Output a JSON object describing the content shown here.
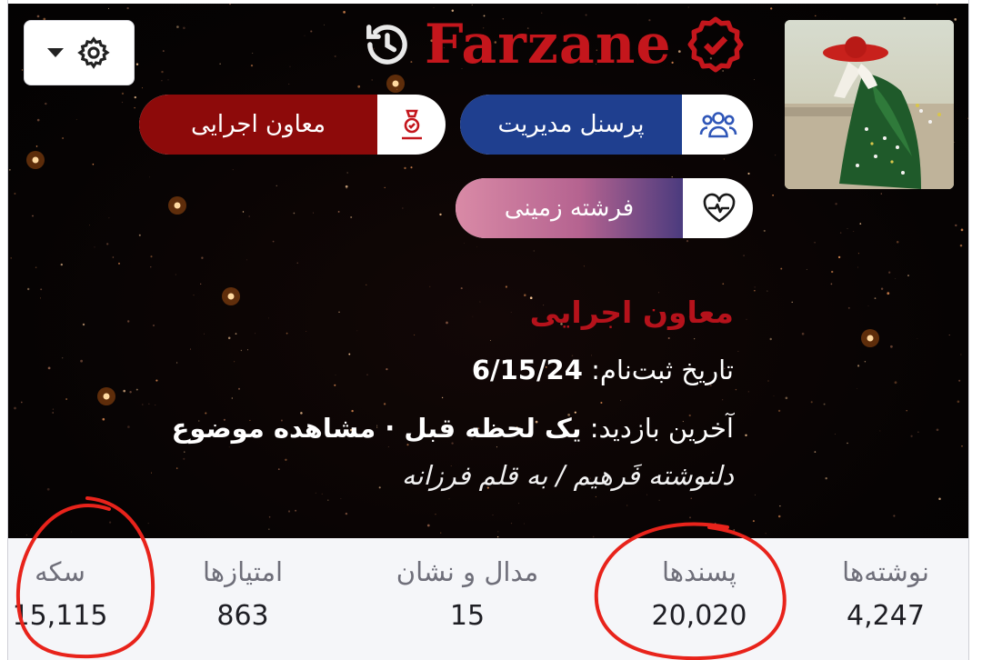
{
  "header": {
    "username": "Farzane",
    "settings_icon": "gear-icon",
    "history_icon": "history-icon",
    "verified_icon": "verified-badge-icon"
  },
  "badges": {
    "management": {
      "label": "پرسنل مدیریت",
      "icon": "users-icon",
      "color": "#1f3f8f"
    },
    "executive": {
      "label": "معاون اجرایی",
      "icon": "award-icon",
      "color": "#8d0a0a"
    },
    "angel": {
      "label": "فرشته زمینی",
      "icon": "heart-pulse-icon",
      "color": "#d07a9a"
    }
  },
  "profile": {
    "role": "معاون اجرایی",
    "joined_label": "تاریخ ثبت‌نام:",
    "joined_value": "6/15/24",
    "last_seen_label": "آخرین بازدید:",
    "last_seen_value": "یک لحظه قبل · مشاهده موضوع",
    "signature": "دلنوشته فَرهیم / به قلم فرزانه"
  },
  "stats": [
    {
      "key": "posts",
      "label": "نوشته‌ها",
      "value": "4,247"
    },
    {
      "key": "likes",
      "label": "پسندها",
      "value": "20,020"
    },
    {
      "key": "medals",
      "label": "مدال و نشان",
      "value": "15"
    },
    {
      "key": "points",
      "label": "امتیازها",
      "value": "863"
    },
    {
      "key": "coins",
      "label": "سکه",
      "value": "15,115"
    }
  ],
  "colors": {
    "brand_red": "#c4161c",
    "annotation_red": "#e8231b"
  }
}
